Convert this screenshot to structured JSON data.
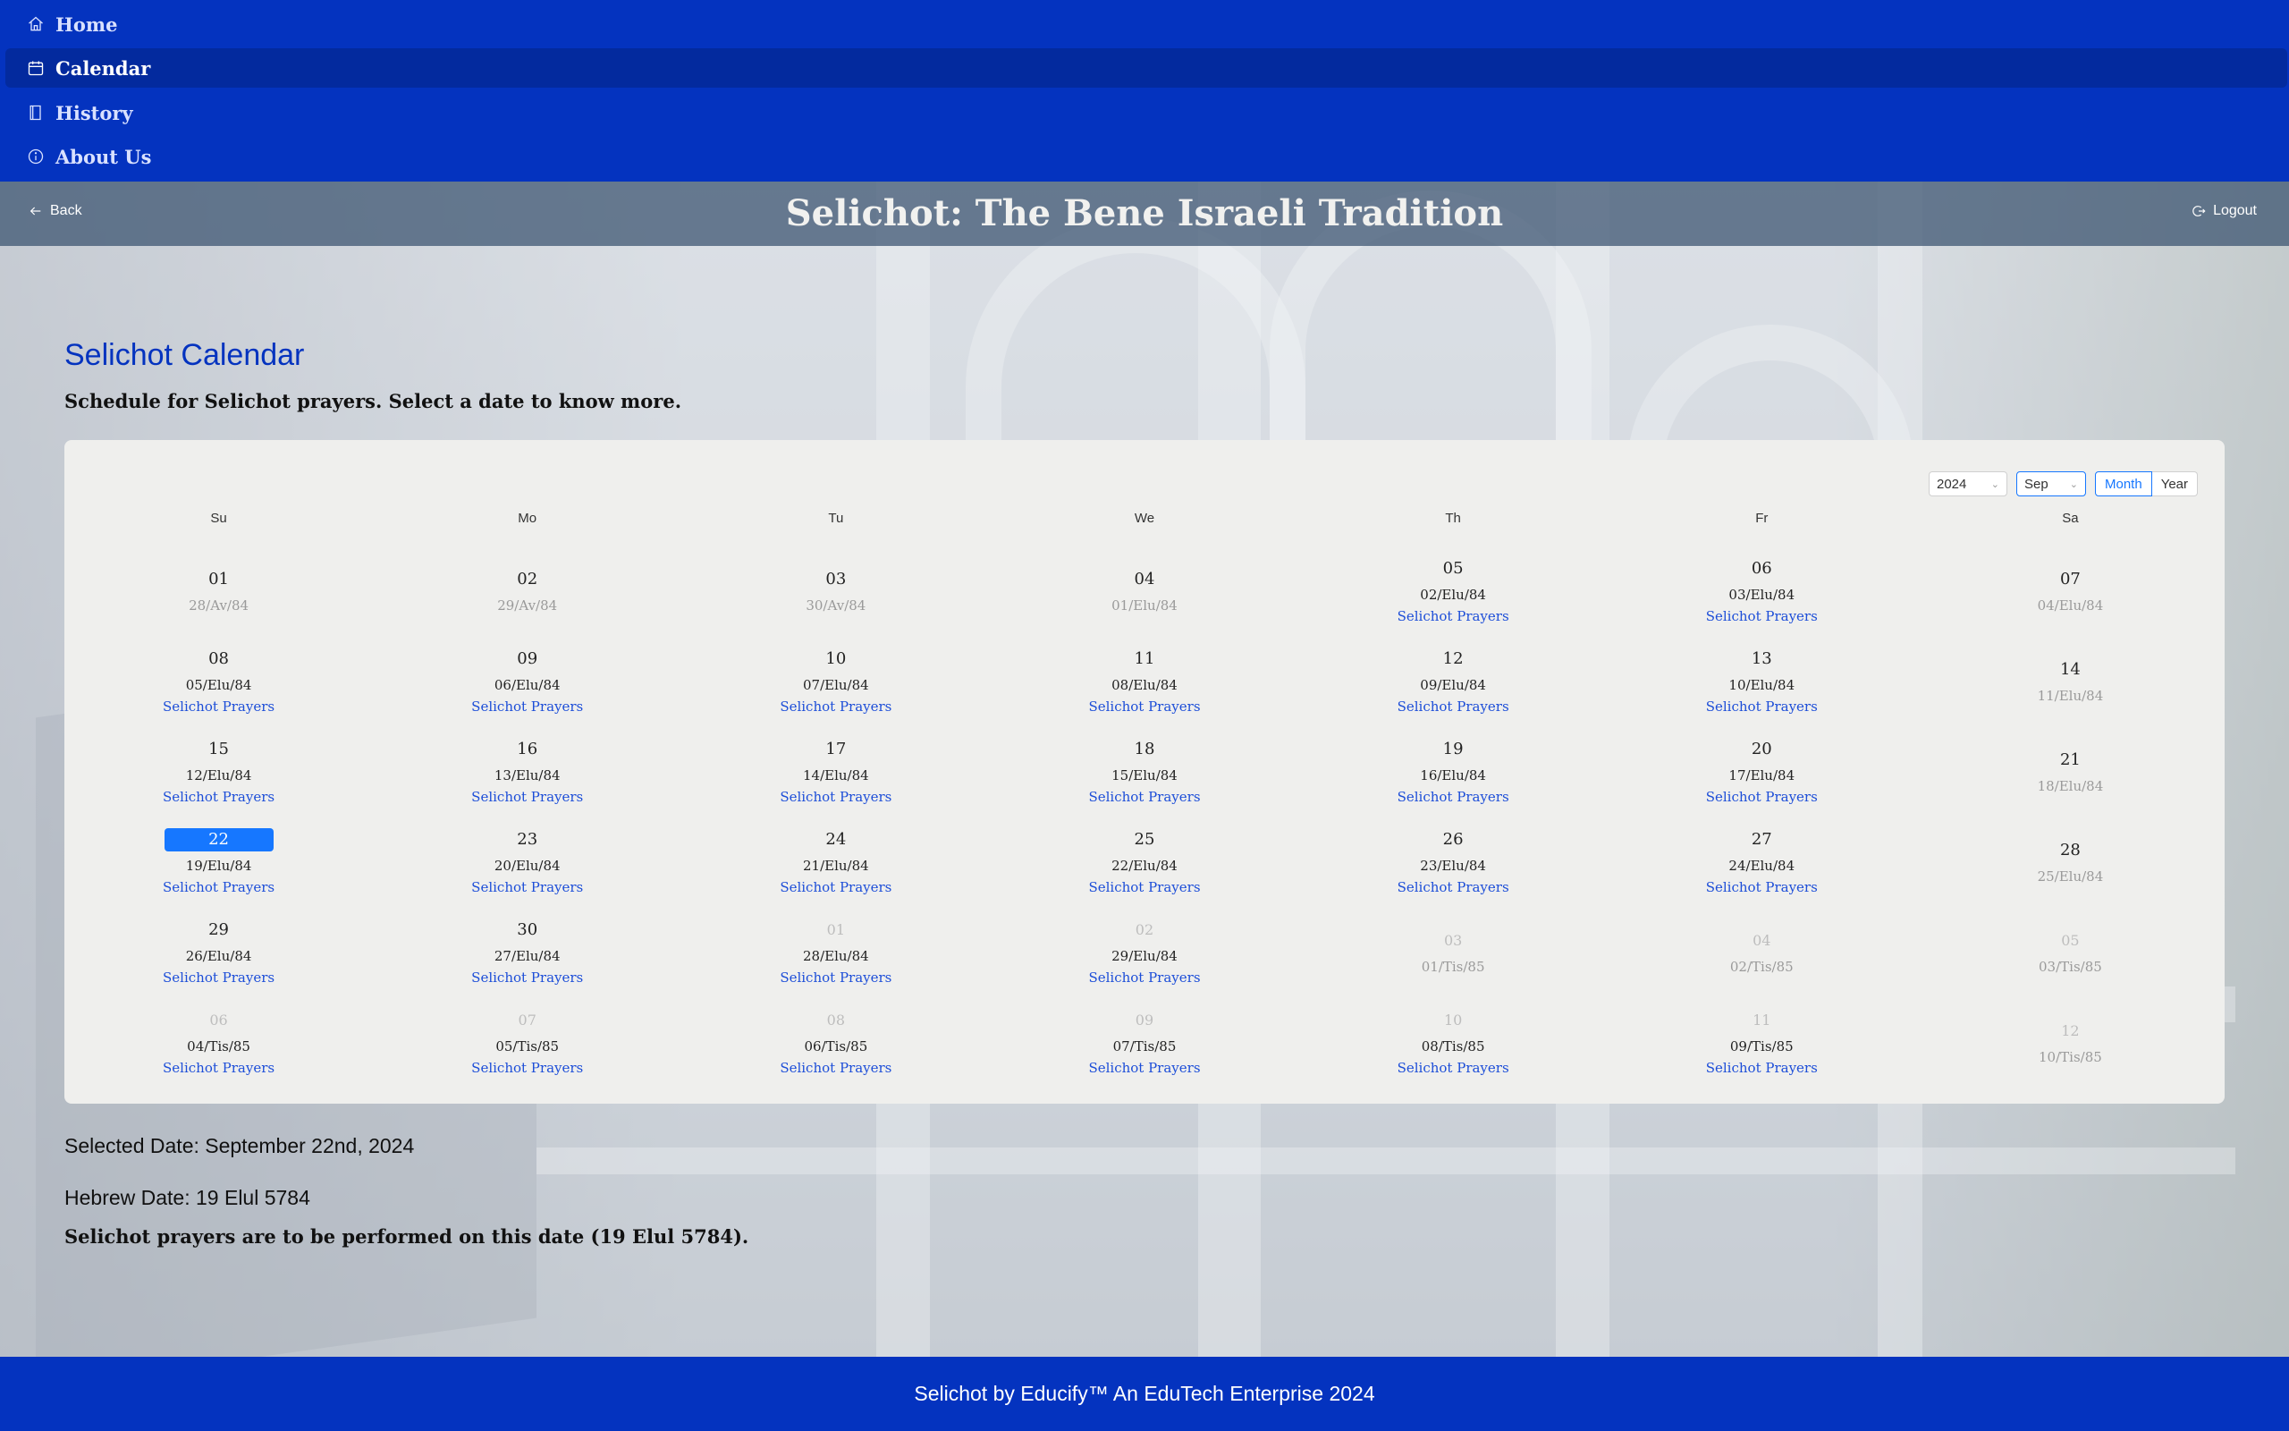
{
  "nav": {
    "items": [
      {
        "label": "Home",
        "icon": "home-icon"
      },
      {
        "label": "Calendar",
        "icon": "calendar-icon"
      },
      {
        "label": "History",
        "icon": "book-icon"
      },
      {
        "label": "About Us",
        "icon": "info-icon"
      }
    ],
    "active": "Calendar"
  },
  "header": {
    "title": "Selichot: The Bene Israeli Tradition",
    "back_label": "Back",
    "logout_label": "Logout"
  },
  "page": {
    "title": "Selichot Calendar",
    "subtitle": "Schedule for Selichot prayers. Select a date to know more."
  },
  "calendar": {
    "year": "2024",
    "month": "Sep",
    "mode_month": "Month",
    "mode_year": "Year",
    "weekdays": [
      "Su",
      "Mo",
      "Tu",
      "We",
      "Th",
      "Fr",
      "Sa"
    ],
    "prayer_label": "Selichot Prayers",
    "weeks": [
      [
        {
          "day": "01",
          "heb": "28/Av/84",
          "prayer": false
        },
        {
          "day": "02",
          "heb": "29/Av/84",
          "prayer": false
        },
        {
          "day": "03",
          "heb": "30/Av/84",
          "prayer": false
        },
        {
          "day": "04",
          "heb": "01/Elu/84",
          "prayer": false
        },
        {
          "day": "05",
          "heb": "02/Elu/84",
          "prayer": true
        },
        {
          "day": "06",
          "heb": "03/Elu/84",
          "prayer": true
        },
        {
          "day": "07",
          "heb": "04/Elu/84",
          "prayer": false
        }
      ],
      [
        {
          "day": "08",
          "heb": "05/Elu/84",
          "prayer": true
        },
        {
          "day": "09",
          "heb": "06/Elu/84",
          "prayer": true
        },
        {
          "day": "10",
          "heb": "07/Elu/84",
          "prayer": true
        },
        {
          "day": "11",
          "heb": "08/Elu/84",
          "prayer": true
        },
        {
          "day": "12",
          "heb": "09/Elu/84",
          "prayer": true
        },
        {
          "day": "13",
          "heb": "10/Elu/84",
          "prayer": true
        },
        {
          "day": "14",
          "heb": "11/Elu/84",
          "prayer": false
        }
      ],
      [
        {
          "day": "15",
          "heb": "12/Elu/84",
          "prayer": true
        },
        {
          "day": "16",
          "heb": "13/Elu/84",
          "prayer": true
        },
        {
          "day": "17",
          "heb": "14/Elu/84",
          "prayer": true
        },
        {
          "day": "18",
          "heb": "15/Elu/84",
          "prayer": true
        },
        {
          "day": "19",
          "heb": "16/Elu/84",
          "prayer": true
        },
        {
          "day": "20",
          "heb": "17/Elu/84",
          "prayer": true
        },
        {
          "day": "21",
          "heb": "18/Elu/84",
          "prayer": false
        }
      ],
      [
        {
          "day": "22",
          "heb": "19/Elu/84",
          "prayer": true,
          "selected": true
        },
        {
          "day": "23",
          "heb": "20/Elu/84",
          "prayer": true
        },
        {
          "day": "24",
          "heb": "21/Elu/84",
          "prayer": true
        },
        {
          "day": "25",
          "heb": "22/Elu/84",
          "prayer": true
        },
        {
          "day": "26",
          "heb": "23/Elu/84",
          "prayer": true
        },
        {
          "day": "27",
          "heb": "24/Elu/84",
          "prayer": true
        },
        {
          "day": "28",
          "heb": "25/Elu/84",
          "prayer": false
        }
      ],
      [
        {
          "day": "29",
          "heb": "26/Elu/84",
          "prayer": true
        },
        {
          "day": "30",
          "heb": "27/Elu/84",
          "prayer": true
        },
        {
          "day": "01",
          "heb": "28/Elu/84",
          "prayer": true,
          "other": true
        },
        {
          "day": "02",
          "heb": "29/Elu/84",
          "prayer": true,
          "other": true
        },
        {
          "day": "03",
          "heb": "01/Tis/85",
          "prayer": false,
          "other": true
        },
        {
          "day": "04",
          "heb": "02/Tis/85",
          "prayer": false,
          "other": true
        },
        {
          "day": "05",
          "heb": "03/Tis/85",
          "prayer": false,
          "other": true
        }
      ],
      [
        {
          "day": "06",
          "heb": "04/Tis/85",
          "prayer": true,
          "other": true
        },
        {
          "day": "07",
          "heb": "05/Tis/85",
          "prayer": true,
          "other": true
        },
        {
          "day": "08",
          "heb": "06/Tis/85",
          "prayer": true,
          "other": true
        },
        {
          "day": "09",
          "heb": "07/Tis/85",
          "prayer": true,
          "other": true
        },
        {
          "day": "10",
          "heb": "08/Tis/85",
          "prayer": true,
          "other": true
        },
        {
          "day": "11",
          "heb": "09/Tis/85",
          "prayer": true,
          "other": true
        },
        {
          "day": "12",
          "heb": "10/Tis/85",
          "prayer": false,
          "other": true
        }
      ]
    ]
  },
  "selection": {
    "selected_date": "Selected Date: September 22nd, 2024",
    "hebrew_date": "Hebrew Date: 19 Elul 5784",
    "note": "Selichot prayers are to be performed on this date (19 Elul 5784)."
  },
  "footer": {
    "text": "Selichot by Educify™ An EduTech Enterprise 2024"
  },
  "colors": {
    "brand": "#0433bf",
    "accent": "#1677ff",
    "link": "#1d4ed8"
  }
}
